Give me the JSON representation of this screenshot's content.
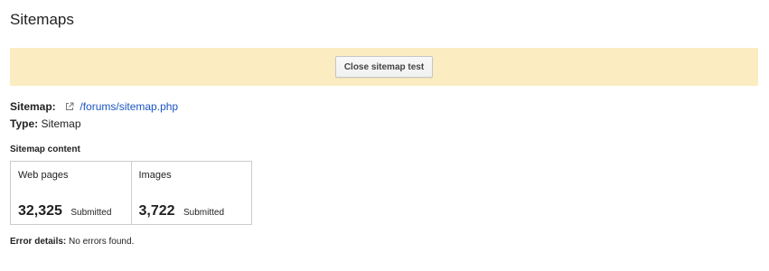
{
  "header": {
    "title": "Sitemaps"
  },
  "banner": {
    "close_button_label": "Close sitemap test",
    "background_color": "#fbecc1"
  },
  "sitemap": {
    "label": "Sitemap:",
    "link_text": "/forums/sitemap.php",
    "link_icon": "external-link-icon",
    "link_color": "#1a55c2"
  },
  "type": {
    "label": "Type:",
    "value": "Sitemap"
  },
  "content": {
    "heading": "Sitemap content",
    "stats": [
      {
        "label": "Web pages",
        "value": "32,325",
        "status": "Submitted"
      },
      {
        "label": "Images",
        "value": "3,722",
        "status": "Submitted"
      }
    ]
  },
  "errors": {
    "label": "Error details:",
    "value": "No errors found."
  }
}
